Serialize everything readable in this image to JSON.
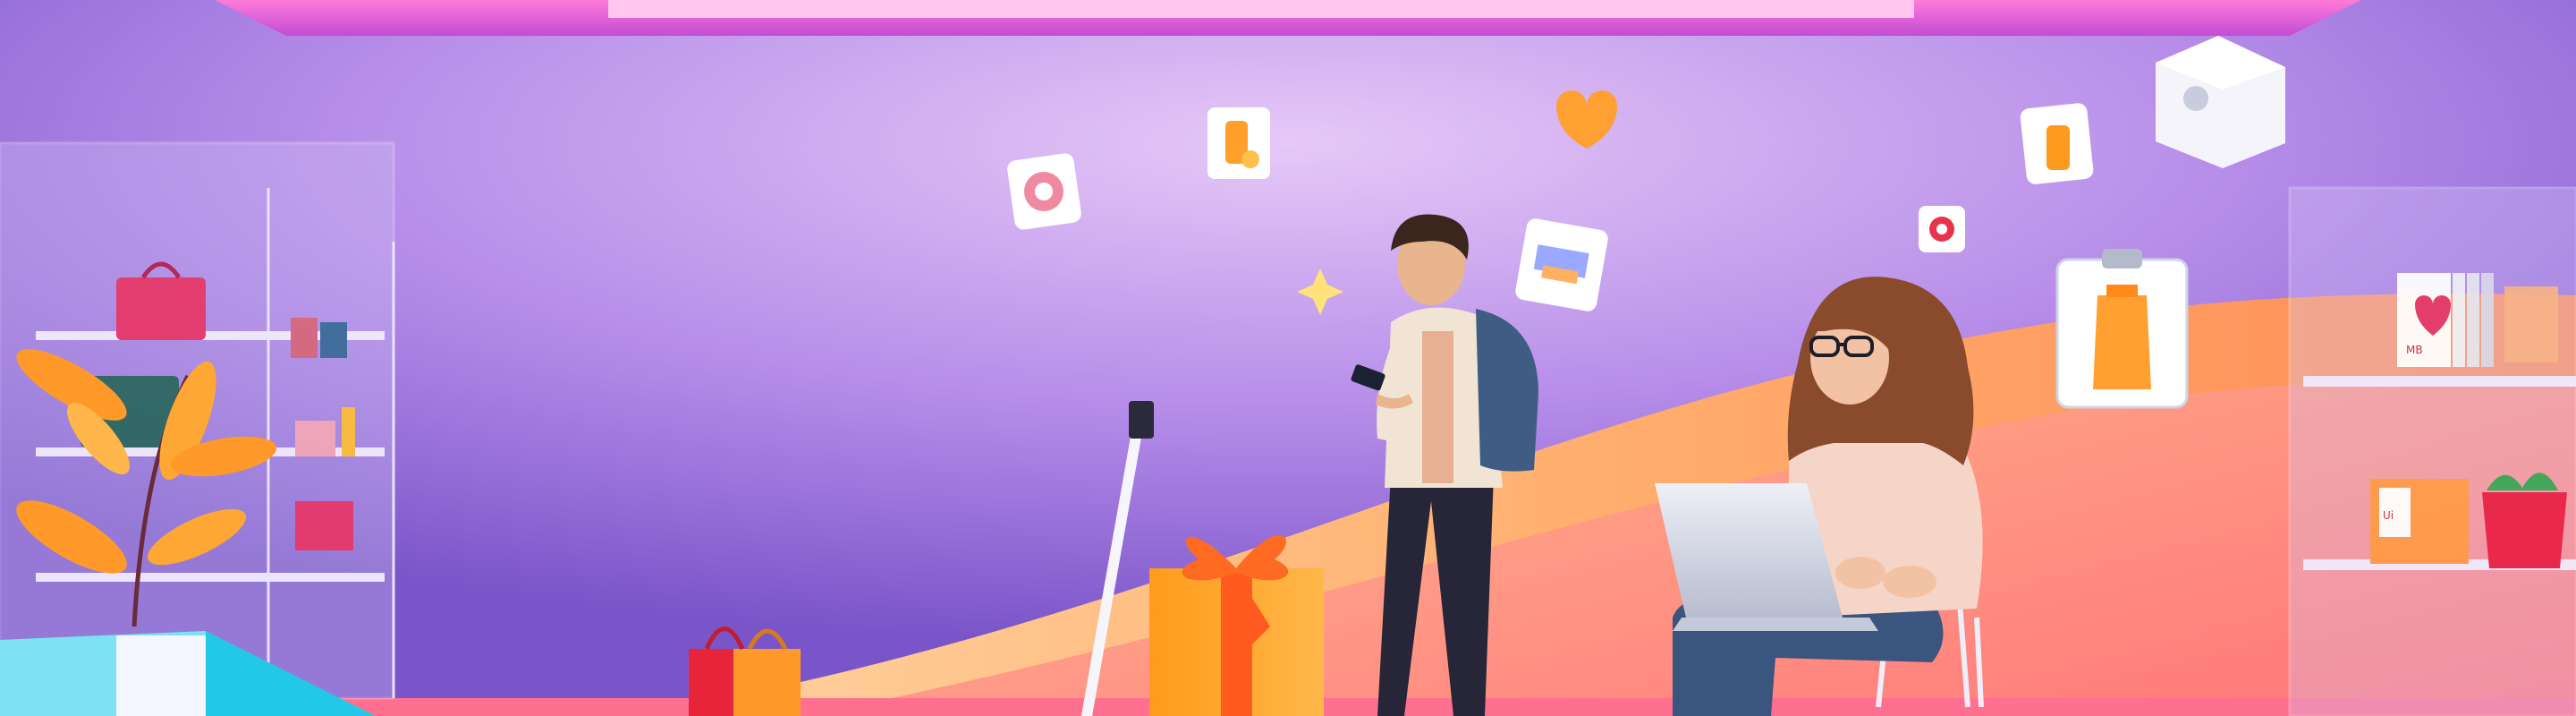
{
  "scene": {
    "palette": {
      "wall_top": "#c9a6f3",
      "wall_bottom": "#a07ae0",
      "ceiling": "#e86ad6",
      "wave_orange": "#ff9b5c",
      "wave_peach": "#ffc28a",
      "floor": "#ff7a8f",
      "shelf_glass": "#d9d2f5",
      "person_shirt": "#f2e4d4",
      "person_jeans": "#2f2f45",
      "woman_sweater": "#f5d5c8",
      "laptop": "#d9dde8",
      "gift_orange": "#ffa534",
      "ribbon": "#ff5a1f"
    },
    "decor_text": {
      "card_left": "Ui",
      "book_right": "MB"
    },
    "icons": [
      "donut-icon",
      "jar-icon",
      "heart-icon",
      "sparkle-icon",
      "card-icon",
      "jar-icon",
      "apple-cube-icon",
      "target-icon",
      "clipboard-jar-icon"
    ]
  }
}
